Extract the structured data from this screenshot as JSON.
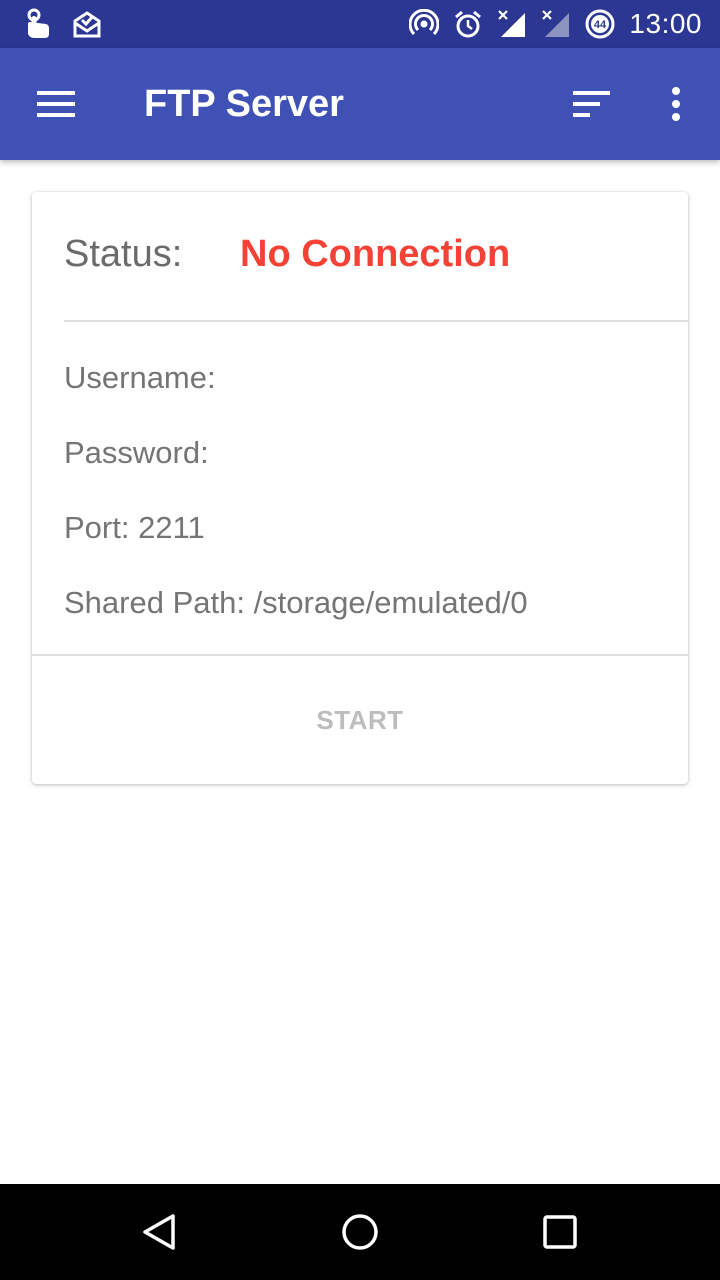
{
  "status_bar": {
    "time": "13:00",
    "battery_level": "44",
    "left_icons": [
      "touch-hand-icon",
      "mail-check-icon"
    ],
    "right_icons": [
      "hotspot-icon",
      "alarm-icon",
      "signal-no-data-icon",
      "signal-no-data-icon",
      "battery-saver-icon"
    ]
  },
  "app_bar": {
    "title": "FTP Server",
    "color": "#3f51b5",
    "icons": [
      "menu-icon",
      "sort-icon",
      "more-vert-icon"
    ]
  },
  "server_card": {
    "status_label": "Status:",
    "status_value": "No Connection",
    "status_color": "#f44336",
    "username": "Username:",
    "password": "Password:",
    "port": "Port: 2211",
    "shared_path": "Shared Path: /storage/emulated/0",
    "start_label": "START"
  },
  "nav_bar": {
    "icons": [
      "back-icon",
      "home-icon",
      "recents-icon"
    ]
  }
}
